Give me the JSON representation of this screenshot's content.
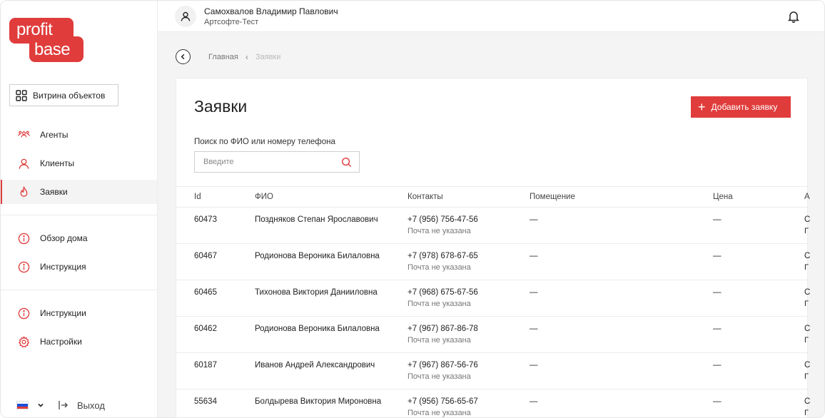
{
  "logo": {
    "line1": "profit",
    "line2": "base"
  },
  "sidebar": {
    "vitrina_label": "Витрина объектов",
    "group1": [
      {
        "label": "Агенты",
        "icon": "agents-icon"
      },
      {
        "label": "Клиенты",
        "icon": "client-icon"
      },
      {
        "label": "Заявки",
        "icon": "fire-icon",
        "active": true
      }
    ],
    "group2": [
      {
        "label": "Обзор дома",
        "icon": "info-icon"
      },
      {
        "label": "Инструкция",
        "icon": "info-icon"
      }
    ],
    "group3": [
      {
        "label": "Инструкции",
        "icon": "info-icon"
      },
      {
        "label": "Настройки",
        "icon": "gear-icon"
      }
    ],
    "language_flag": "ru-flag-icon",
    "exit_label": "Выход"
  },
  "header": {
    "user_name": "Самохвалов Владимир Павлович",
    "user_org": "Артсофте-Тест"
  },
  "breadcrumbs": {
    "home": "Главная",
    "current": "Заявки"
  },
  "page": {
    "title": "Заявки",
    "add_button": "Добавить заявку",
    "search_label": "Поиск по ФИО или номеру телефона",
    "search_placeholder": "Введите"
  },
  "table": {
    "headers": {
      "id": "Id",
      "fio": "ФИО",
      "contacts": "Контакты",
      "room": "Помещение",
      "price": "Цена",
      "extra": "А"
    },
    "rows": [
      {
        "id": "60473",
        "fio": "Поздняков Степан Ярославович",
        "phone": "+7 (956) 756-47-56",
        "email": "Почта не указана",
        "room": "—",
        "price": "—",
        "extra1": "С",
        "extra2": "Г"
      },
      {
        "id": "60467",
        "fio": "Родионова Вероника Билаловна",
        "phone": "+7 (978) 678-67-65",
        "email": "Почта не указана",
        "room": "—",
        "price": "—",
        "extra1": "С",
        "extra2": "Г"
      },
      {
        "id": "60465",
        "fio": "Тихонова Виктория Данииловна",
        "phone": "+7 (968) 675-67-56",
        "email": "Почта не указана",
        "room": "—",
        "price": "—",
        "extra1": "С",
        "extra2": "Г"
      },
      {
        "id": "60462",
        "fio": "Родионова Вероника Билаловна",
        "phone": "+7 (967) 867-86-78",
        "email": "Почта не указана",
        "room": "—",
        "price": "—",
        "extra1": "С",
        "extra2": "Г"
      },
      {
        "id": "60187",
        "fio": "Иванов Андрей Александрович",
        "phone": "+7 (967) 867-56-76",
        "email": "Почта не указана",
        "room": "—",
        "price": "—",
        "extra1": "С",
        "extra2": "Г"
      },
      {
        "id": "55634",
        "fio": "Болдырева Виктория Мироновна",
        "phone": "+7 (956) 756-65-67",
        "email": "Почта не указана",
        "room": "—",
        "price": "—",
        "extra1": "С",
        "extra2": "Г"
      }
    ]
  },
  "colors": {
    "accent": "#e03c3c",
    "bg": "#f4f4f5"
  }
}
